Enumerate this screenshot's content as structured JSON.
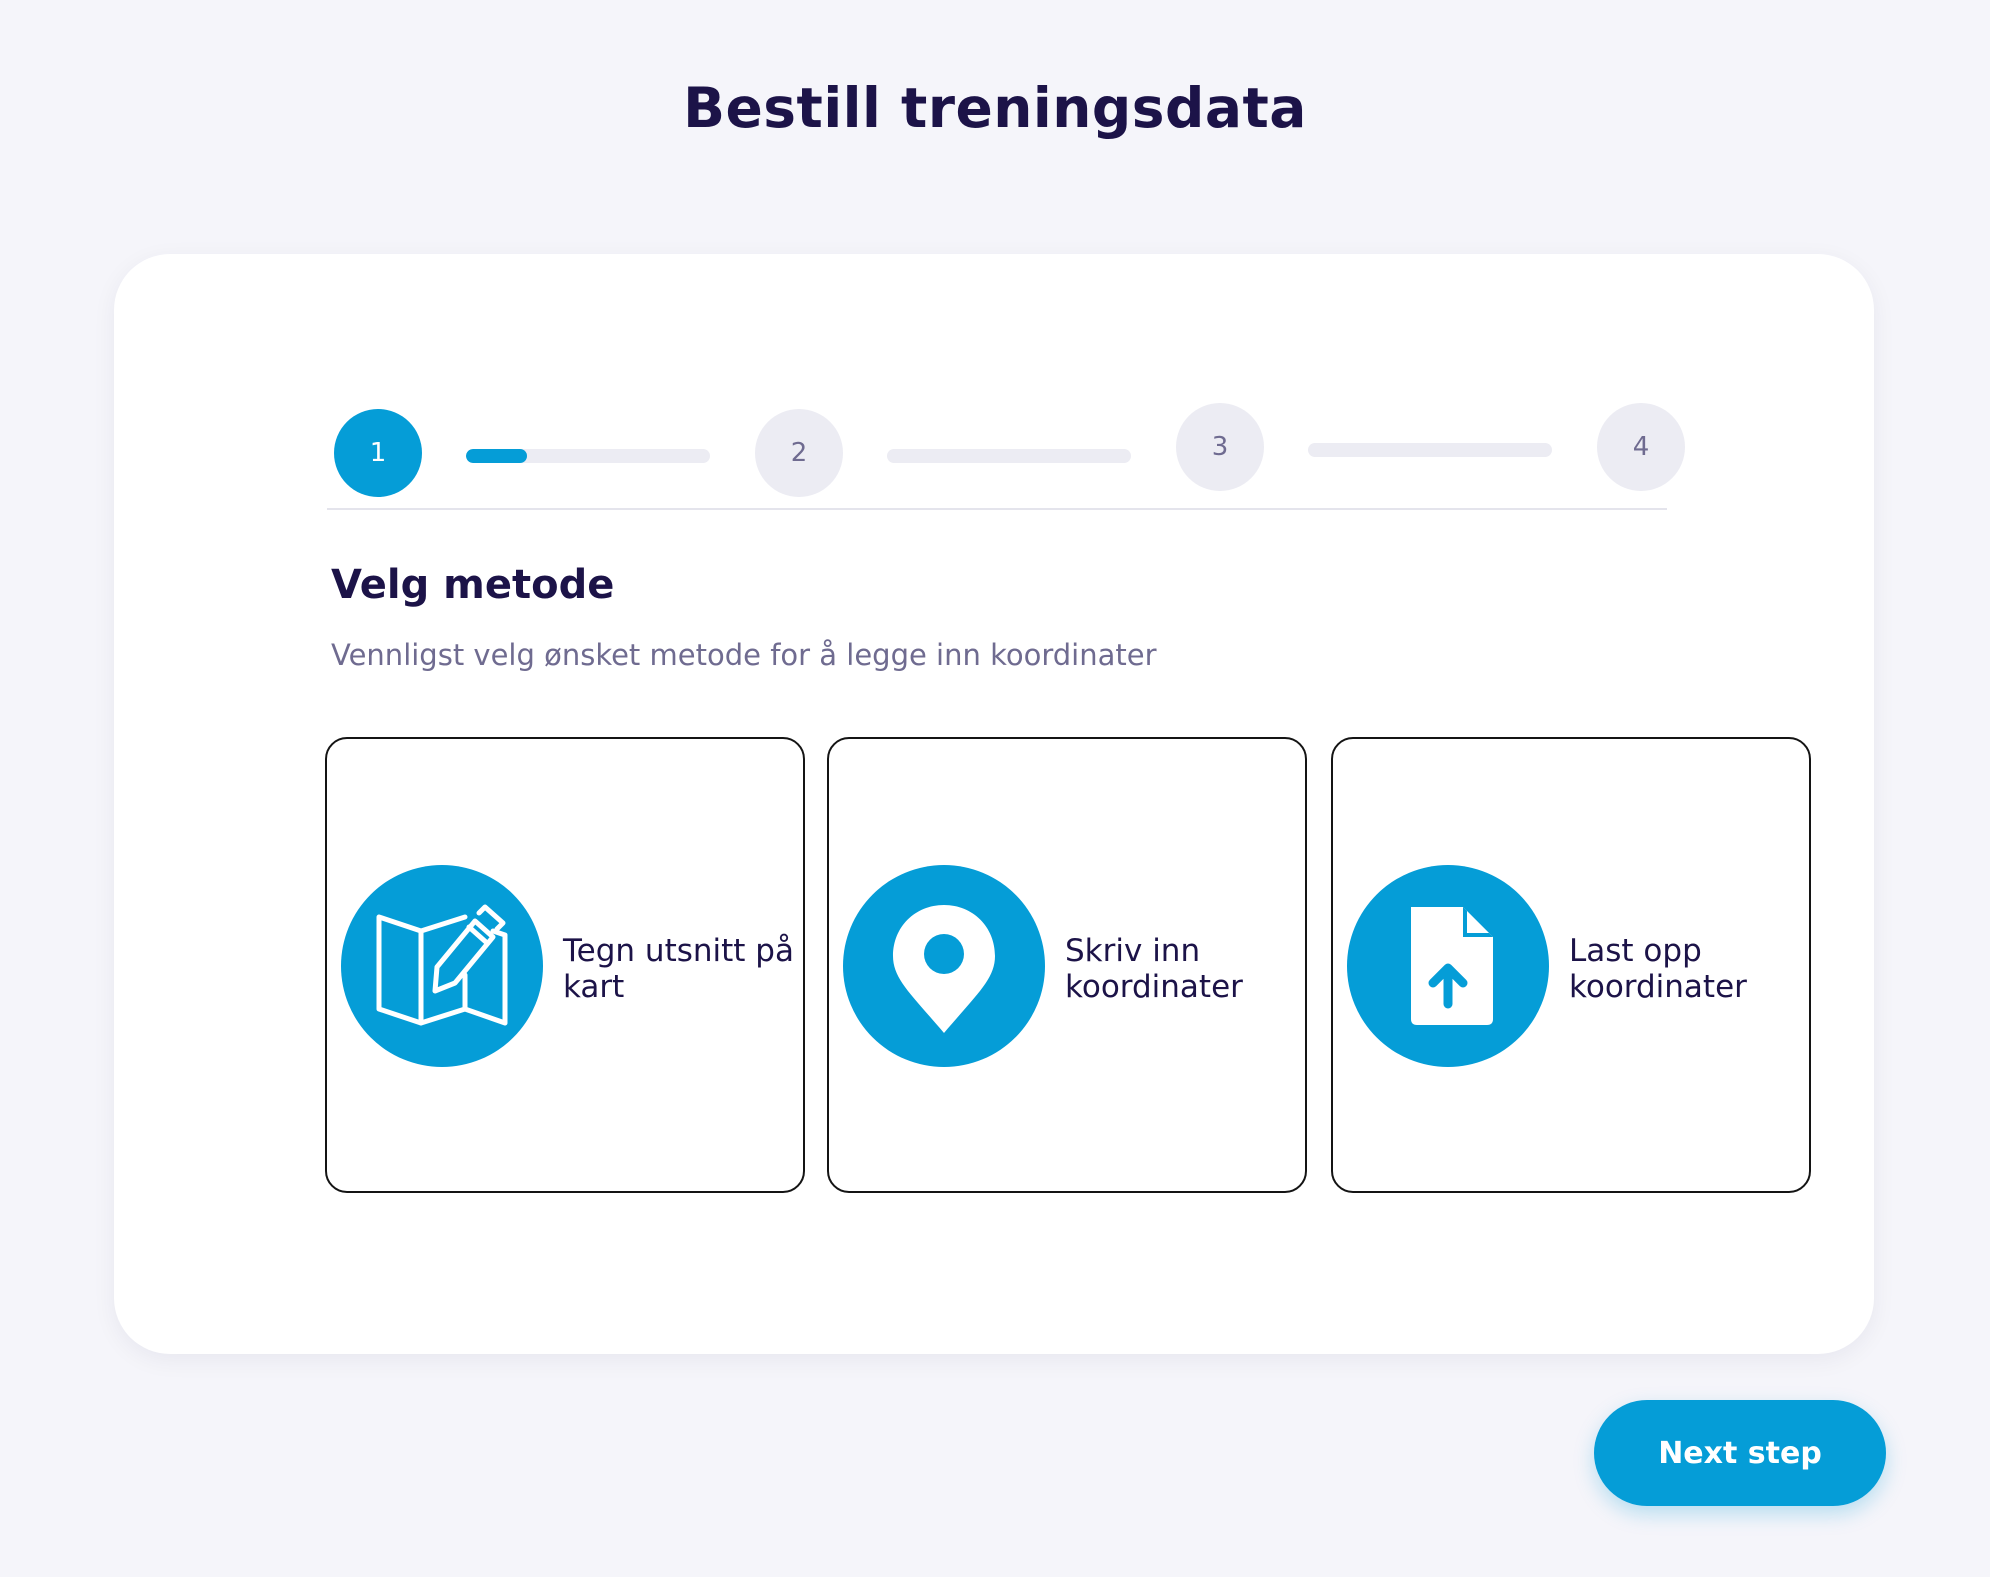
{
  "page": {
    "title": "Bestill treningsdata"
  },
  "stepper": {
    "steps": [
      {
        "label": "1",
        "state": "active"
      },
      {
        "label": "2",
        "state": "inactive"
      },
      {
        "label": "3",
        "state": "inactive"
      },
      {
        "label": "4",
        "state": "inactive"
      }
    ],
    "progress_fraction": 0.25
  },
  "section": {
    "title": "Velg metode",
    "subtitle": "Vennligst velg ønsket metode for å legge inn koordinater"
  },
  "methods": [
    {
      "label": "Tegn utsnitt på kart",
      "icon": "map-draw-icon"
    },
    {
      "label": "Skriv inn koordinater",
      "icon": "location-pin-icon"
    },
    {
      "label": "Last opp koordinater",
      "icon": "file-upload-icon"
    }
  ],
  "actions": {
    "next_label": "Next step"
  },
  "colors": {
    "accent": "#059dd7",
    "heading": "#1c1348",
    "muted_text": "#6f6b90",
    "background": "#f5f5fa",
    "inactive_step": "#ececf3"
  }
}
